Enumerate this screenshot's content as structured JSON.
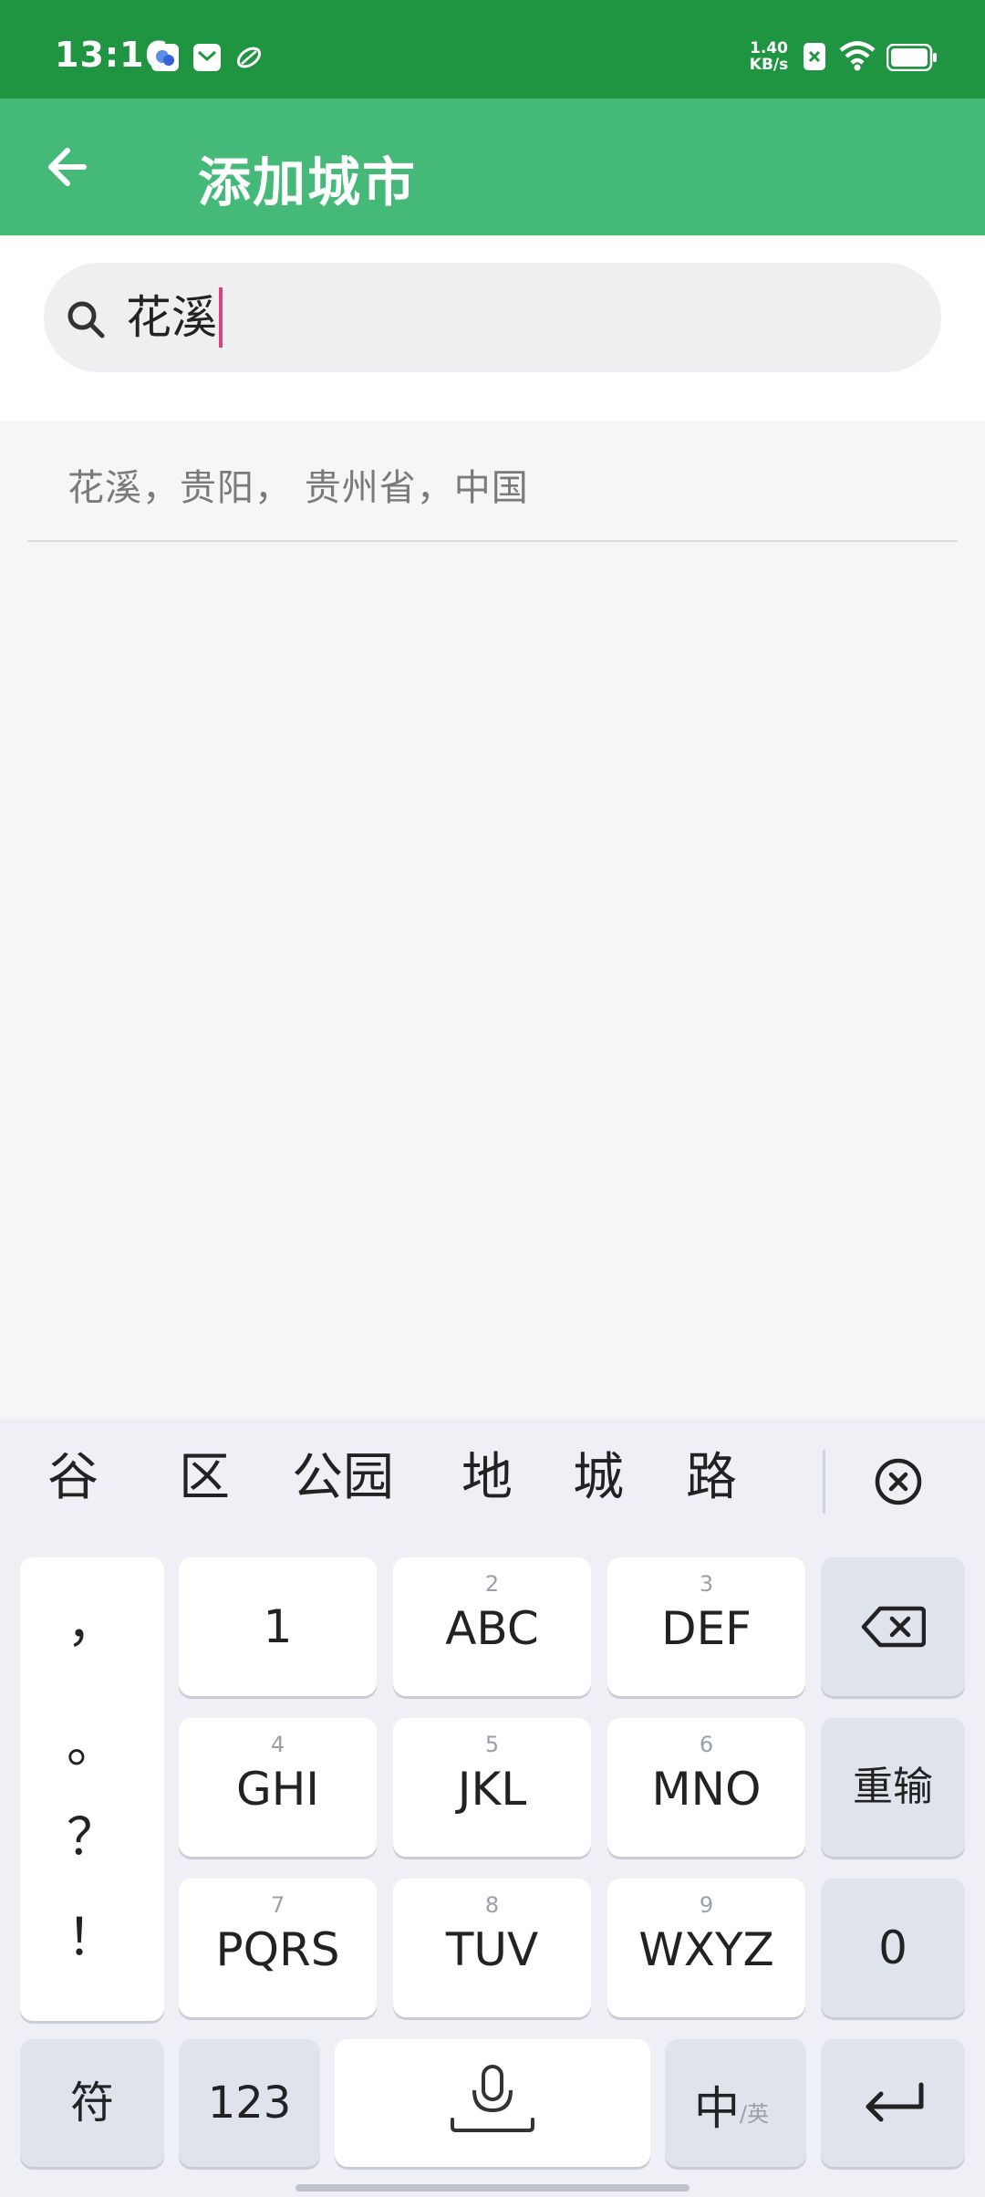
{
  "status_bar": {
    "time": "13:16",
    "net_speed_value": "1.40",
    "net_speed_unit": "KB/s",
    "icons": [
      "app-notification-icon",
      "mail-notification-icon",
      "leaf-notification-icon",
      "no-sim-icon",
      "wifi-icon",
      "battery-icon"
    ]
  },
  "app_bar": {
    "title": "添加城市",
    "back_icon": "arrow-left-icon",
    "background": "#44b978"
  },
  "search": {
    "value": "花溪",
    "icon": "search-icon",
    "caret_color": "#e0417c"
  },
  "results": [
    {
      "label": "花溪，贵阳， 贵州省，中国"
    }
  ],
  "keyboard": {
    "candidates": [
      "谷",
      "区",
      "公园",
      "地",
      "城",
      "路"
    ],
    "punctuation": [
      "，",
      "。",
      "？",
      "！"
    ],
    "keys": {
      "one": "1",
      "abc_num": "2",
      "abc": "ABC",
      "def_num": "3",
      "def": "DEF",
      "ghi_num": "4",
      "ghi": "GHI",
      "jkl_num": "5",
      "jkl": "JKL",
      "mno_num": "6",
      "mno": "MNO",
      "pqrs_num": "7",
      "pqrs": "PQRS",
      "tuv_num": "8",
      "tuv": "TUV",
      "wxyz_num": "9",
      "wxyz": "WXYZ",
      "reset": "重输",
      "zero": "0",
      "symbols": "符",
      "numbers": "123",
      "lang_main": "中",
      "lang_alt": "/英"
    }
  }
}
